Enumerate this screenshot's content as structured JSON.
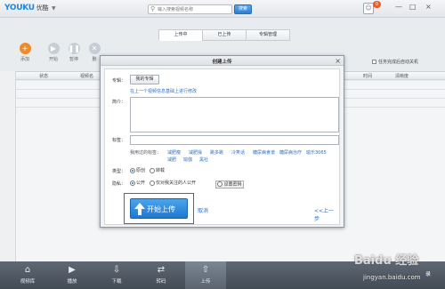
{
  "app": {
    "logo": "YOUKU",
    "logo_cn": "优酷"
  },
  "search": {
    "placeholder": "输入搜索视频名称",
    "button": "搜索"
  },
  "notifications": {
    "count": "0"
  },
  "window_controls": [
    "—",
    "□",
    "×"
  ],
  "tabs": [
    {
      "label": "上传中"
    },
    {
      "label": "已上传"
    },
    {
      "label": "专辑管理"
    }
  ],
  "toolbar": {
    "items": [
      {
        "label": "添加",
        "icon": "plus-icon"
      },
      {
        "label": "开始",
        "icon": "play-icon"
      },
      {
        "label": "暂停",
        "icon": "pause-icon"
      },
      {
        "label": "删",
        "icon": "delete-icon"
      }
    ],
    "auto_close": "任务完成后自动关机"
  },
  "table": {
    "columns": [
      "状态",
      "视频名",
      "时间",
      "清晰度"
    ]
  },
  "dialog": {
    "title": "创建上传",
    "collection_label": "专辑：",
    "collection_button": "我的专辑",
    "modify_link": "在上一个视频信息基础上进行修改",
    "intro_label": "简介：",
    "tags_label": "标签：",
    "used_tags_label": "我用过的标签：",
    "used_tags": [
      "减肥瘦",
      "减肥操",
      "跳多跳",
      "冷笑话",
      "糖尿病食谱",
      "糖尿病治疗",
      "瑜乐3065",
      "减肥",
      "瑜伽",
      "黑社"
    ],
    "category_label": "类型：",
    "category_options": [
      {
        "label": "原创",
        "selected": true
      },
      {
        "label": "转载",
        "selected": false
      }
    ],
    "privacy_label": "隐私：",
    "privacy_options": [
      {
        "label": "公开",
        "selected": true
      },
      {
        "label": "仅对我关注的人公开",
        "selected": false
      },
      {
        "label": "设置密码",
        "selected": false
      }
    ],
    "upload_button": "开始上传",
    "cancel_link": "取消",
    "prev_link": "<<上一步"
  },
  "bottom_nav": [
    {
      "label": "视频库",
      "icon": "home-icon"
    },
    {
      "label": "播放",
      "icon": "play-icon"
    },
    {
      "label": "下载",
      "icon": "download-icon"
    },
    {
      "label": "转码",
      "icon": "transcode-icon"
    },
    {
      "label": "上传",
      "icon": "upload-icon",
      "active": true
    }
  ],
  "watermark": {
    "main": "Baidu 经验",
    "sub": "jingyan.baidu.com",
    "edge": "录"
  },
  "colors": {
    "accent": "#1f78cf",
    "highlight_border": "#e0312a",
    "link": "#2f6fc3"
  }
}
